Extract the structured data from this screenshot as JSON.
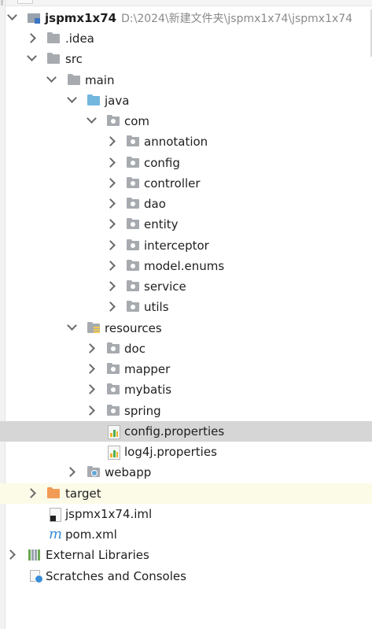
{
  "project": {
    "name": "jspmx1x74",
    "path": "D:\\2024\\新建文件夹\\jspmx1x74\\jspmx1x74"
  },
  "tree": {
    "idea": ".idea",
    "src": "src",
    "main": "main",
    "java": "java",
    "com": "com",
    "packages": [
      "annotation",
      "config",
      "controller",
      "dao",
      "entity",
      "interceptor",
      "model.enums",
      "service",
      "utils"
    ],
    "resources": "resources",
    "resource_folders": [
      "doc",
      "mapper",
      "mybatis",
      "spring"
    ],
    "config_properties": "config.properties",
    "log4j_properties": "log4j.properties",
    "webapp": "webapp",
    "target": "target",
    "iml": "jspmx1x74.iml",
    "pom": "pom.xml"
  },
  "footer": {
    "external_libraries": "External Libraries",
    "scratches": "Scratches and Consoles"
  },
  "pom_glyph": "m",
  "colors": {
    "selected_row": "#d6d6d6",
    "excluded_row": "#fcfbe8",
    "folder_gray": "#a7abb0",
    "folder_blue": "#71b7de",
    "folder_orange": "#f29b55"
  }
}
